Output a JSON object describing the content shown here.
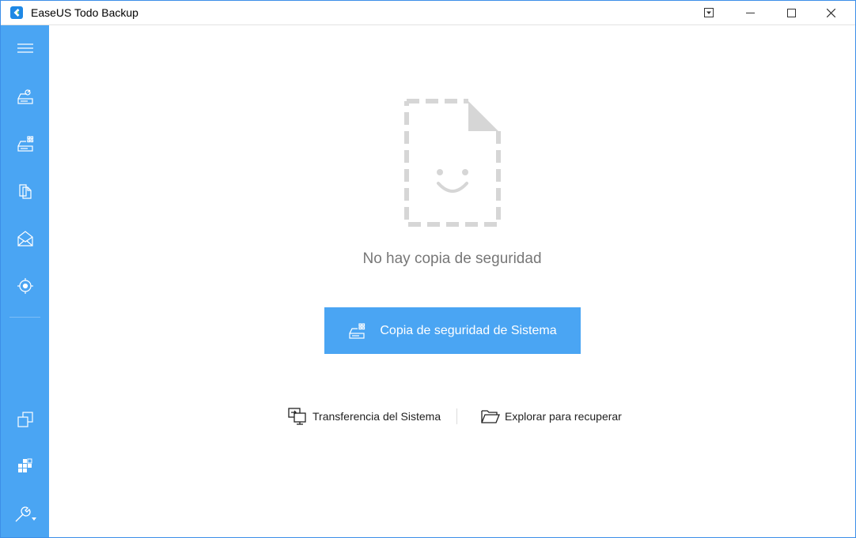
{
  "window": {
    "title": "EaseUS Todo Backup"
  },
  "titlebar_buttons": [
    "dropdown-menu",
    "minimize",
    "maximize",
    "close"
  ],
  "sidebar": {
    "items_top": [
      "menu-icon",
      "disk-backup-icon",
      "system-backup-icon",
      "file-backup-icon",
      "mail-backup-icon",
      "smart-backup-icon"
    ],
    "items_bottom": [
      "clone-icon",
      "system-transfer-icon",
      "tools-icon"
    ]
  },
  "main": {
    "empty_message": "No hay copia de seguridad",
    "primary_button_label": "Copia de seguridad de Sistema",
    "links": {
      "system_transfer": "Transferencia del Sistema",
      "browse_recover": "Explorar para recuperar"
    }
  },
  "colors": {
    "accent": "#4aa5f3",
    "placeholder": "#d6d6d6",
    "message": "#777777"
  }
}
